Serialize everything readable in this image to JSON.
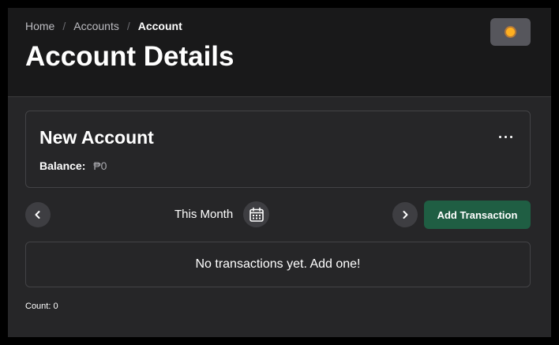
{
  "breadcrumb": {
    "items": [
      "Home",
      "Accounts"
    ],
    "current": "Account",
    "separator": "/"
  },
  "page": {
    "title": "Account Details"
  },
  "header": {
    "theme_icon": "sun-icon"
  },
  "account": {
    "name": "New Account",
    "balance_label": "Balance:",
    "balance_value": "₱0",
    "menu_icon": "more-horizontal-icon"
  },
  "period": {
    "label": "This Month",
    "prev_icon": "chevron-left-icon",
    "next_icon": "chevron-right-icon",
    "calendar_icon": "calendar-icon"
  },
  "actions": {
    "add_transaction_label": "Add Transaction"
  },
  "transactions": {
    "empty_message": "No transactions yet. Add one!",
    "count_text": "Count: 0"
  },
  "colors": {
    "page_background": "#262628",
    "header_background": "#19191a",
    "primary_button": "#1f5e43",
    "sun_accent": "#ffb020"
  }
}
